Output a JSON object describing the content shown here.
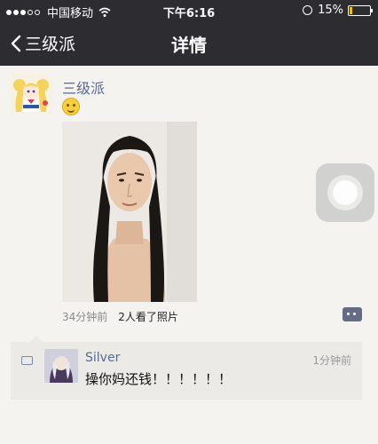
{
  "status_bar": {
    "carrier": "中国移动",
    "time": "下午6:16",
    "battery_text": "15%",
    "battery_level": 0.15,
    "signal_dots": [
      true,
      true,
      true,
      false,
      false
    ],
    "colors": {
      "bg": "#2d2c31",
      "battery": "#f2c200"
    }
  },
  "nav": {
    "back_label": "三级派",
    "title": "详情"
  },
  "post": {
    "author": "三级派",
    "emoji": "smiling-face-icon",
    "time_ago": "34分钟前",
    "viewers": "2人看了照片"
  },
  "comments": [
    {
      "author": "Silver",
      "time": "1分钟前",
      "text": "操你妈还钱！！！！！！"
    }
  ],
  "icons": {
    "back": "chevron-left-icon",
    "wifi": "wifi-icon",
    "lock": "rotation-lock-icon",
    "battery": "battery-icon",
    "comment_action": "more-dots-icon",
    "comment_list": "comment-bubble-icon",
    "assistive_touch": "assistive-touch-icon"
  }
}
